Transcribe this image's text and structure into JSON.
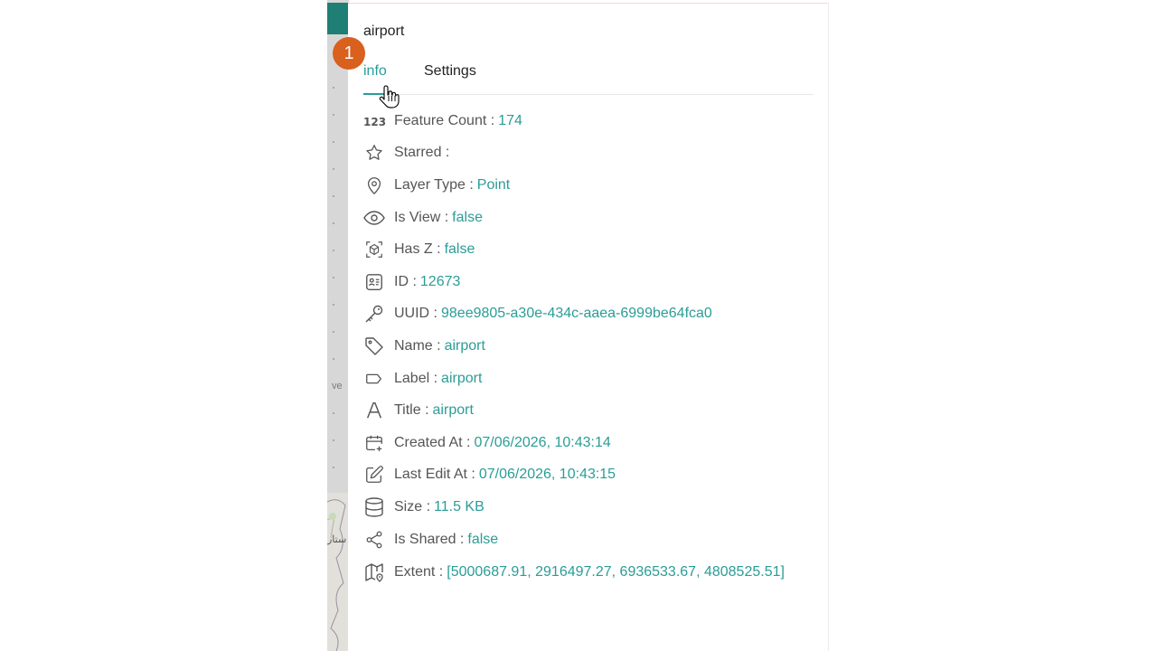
{
  "badge": {
    "number": "1"
  },
  "panel": {
    "title": "airport",
    "tabs": [
      {
        "label": "info"
      },
      {
        "label": "Settings"
      }
    ]
  },
  "map": {
    "side_text_1": "ve",
    "side_text_2": "ستار"
  },
  "info": {
    "rows": [
      {
        "icon": "numbers-icon",
        "label": "Feature Count :",
        "value": "174"
      },
      {
        "icon": "star-icon",
        "label": "Starred :",
        "value": ""
      },
      {
        "icon": "location-pin-icon",
        "label": "Layer Type :",
        "value": "Point"
      },
      {
        "icon": "eye-icon",
        "label": "Is View :",
        "value": "false"
      },
      {
        "icon": "cube-icon",
        "label": "Has Z :",
        "value": "false"
      },
      {
        "icon": "id-card-icon",
        "label": "ID :",
        "value": "12673"
      },
      {
        "icon": "key-icon",
        "label": "UUID :",
        "value": "98ee9805-a30e-434c-aaea-6999be64fca0"
      },
      {
        "icon": "tag-icon",
        "label": "Name :",
        "value": "airport"
      },
      {
        "icon": "label-icon",
        "label": "Label :",
        "value": "airport"
      },
      {
        "icon": "title-icon",
        "label": "Title :",
        "value": "airport"
      },
      {
        "icon": "calendar-plus-icon",
        "label": "Created At :",
        "value": "07/06/2026, 10:43:14"
      },
      {
        "icon": "edit-icon",
        "label": "Last Edit At :",
        "value": "07/06/2026, 10:43:15"
      },
      {
        "icon": "database-icon",
        "label": "Size :",
        "value": "11.5 KB"
      },
      {
        "icon": "share-icon",
        "label": "Is Shared :",
        "value": "false"
      },
      {
        "icon": "map-icon",
        "label": "Extent :",
        "value": "[5000687.91, 2916497.27, 6936533.67, 4808525.51]"
      }
    ]
  },
  "colors": {
    "accent": "#2a9d96",
    "badge": "#d9601d",
    "map_header": "#1f7f74"
  }
}
